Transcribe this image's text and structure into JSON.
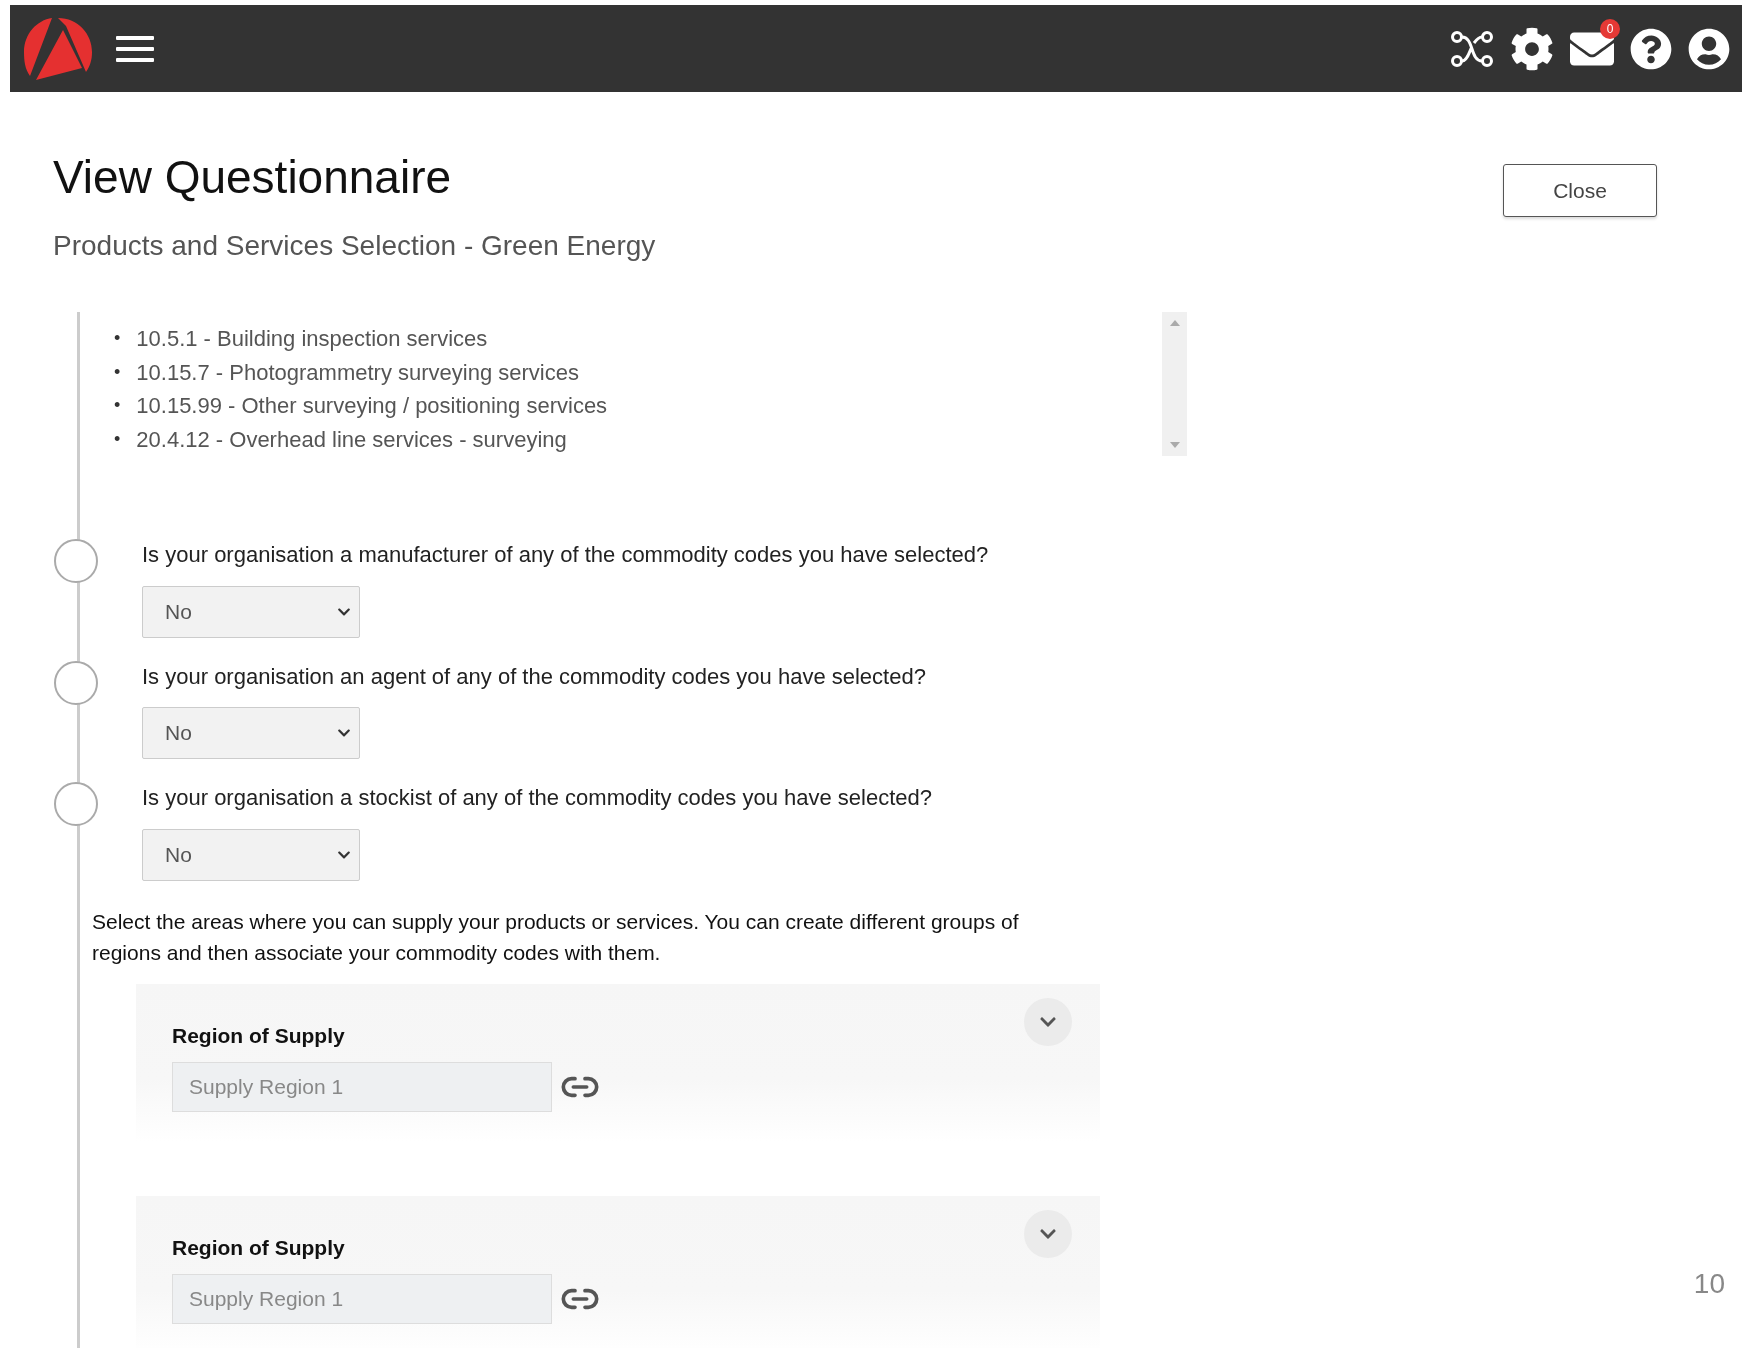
{
  "topbar": {
    "notification_count": "0"
  },
  "title": "View Questionnaire",
  "subtitle": "Products and Services Selection - Green Energy",
  "close_button": "Close",
  "commodity_codes": [
    {
      "bullet": "•",
      "text": "10.5.1 - Building inspection services"
    },
    {
      "bullet": "•",
      "text": "10.15.7 - Photogrammetry surveying services"
    },
    {
      "bullet": "•",
      "text": "10.15.99 - Other surveying / positioning services"
    },
    {
      "bullet": "•",
      "text": "20.4.12 - Overhead line services - surveying"
    }
  ],
  "questions": [
    {
      "question": "Is your organisation a manufacturer of any of the commodity codes you have selected?",
      "answer": "No"
    },
    {
      "question": "Is your organisation an agent of any of the commodity codes you have selected?",
      "answer": "No"
    },
    {
      "question": "Is your organisation a stockist of any of the commodity codes you have selected?",
      "answer": "No"
    }
  ],
  "supply_intro": "Select the areas where you can supply your products or services. You can create different groups of regions and then associate your commodity codes with them.",
  "regions": [
    {
      "label": "Region of Supply",
      "value": "Supply Region 1"
    },
    {
      "label": "Region of Supply",
      "value": "Supply Region 1"
    }
  ],
  "page_number": "10"
}
